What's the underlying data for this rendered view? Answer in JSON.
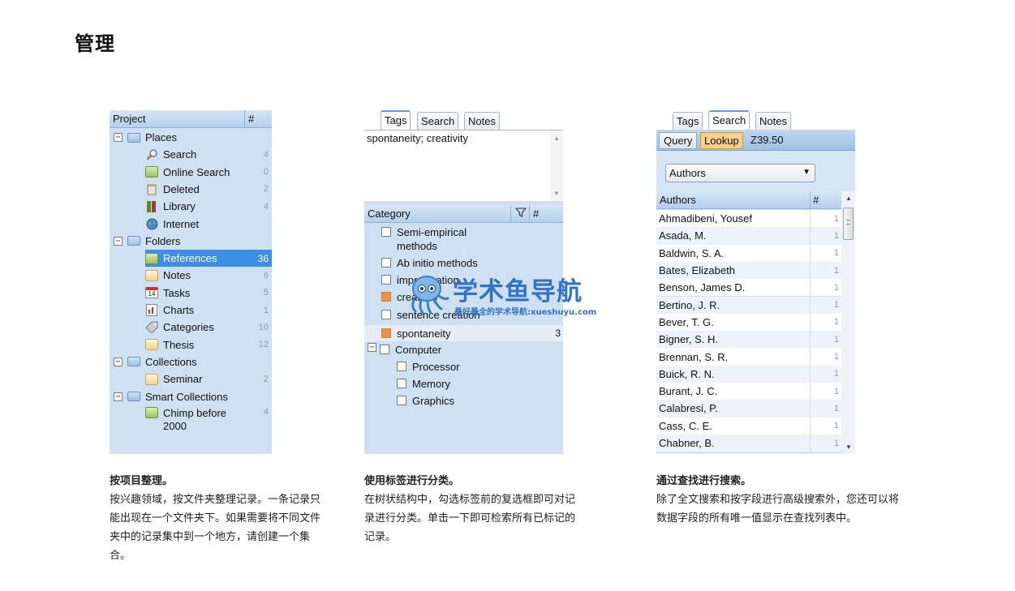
{
  "page": {
    "title": "管理"
  },
  "project_panel": {
    "header": {
      "project_label": "Project",
      "count_label": "#"
    },
    "tree": [
      {
        "label": "Places",
        "kind": "group",
        "count": ""
      },
      {
        "label": "Search",
        "kind": "search-icon",
        "count": "4"
      },
      {
        "label": "Online Search",
        "kind": "online-search-icon",
        "count": "0"
      },
      {
        "label": "Deleted",
        "kind": "trash-icon",
        "count": "2"
      },
      {
        "label": "Library",
        "kind": "library-icon",
        "count": "4"
      },
      {
        "label": "Internet",
        "kind": "globe-icon",
        "count": ""
      },
      {
        "label": "Folders",
        "kind": "group",
        "count": ""
      },
      {
        "label": "References",
        "kind": "folder-green-icon",
        "count": "36",
        "selected": true
      },
      {
        "label": "Notes",
        "kind": "note-icon",
        "count": "6"
      },
      {
        "label": "Tasks",
        "kind": "calendar-icon",
        "count": "5"
      },
      {
        "label": "Charts",
        "kind": "chart-icon",
        "count": "1"
      },
      {
        "label": "Categories",
        "kind": "tag-icon",
        "count": "10"
      },
      {
        "label": "Thesis",
        "kind": "note-icon",
        "count": "12"
      },
      {
        "label": "Collections",
        "kind": "group",
        "count": ""
      },
      {
        "label": "Seminar",
        "kind": "note-icon",
        "count": "2"
      },
      {
        "label": "Smart Collections",
        "kind": "group",
        "count": ""
      },
      {
        "label": "Chimp before",
        "label2": "2000",
        "kind": "folder-green-icon",
        "count": "4"
      }
    ]
  },
  "tags_panel": {
    "tabs": [
      "Tags",
      "Search",
      "Notes"
    ],
    "tags_text": "spontaneity; creativity",
    "category_header": {
      "label": "Category",
      "filter_icon": "filter-icon",
      "count_label": "#"
    },
    "categories": [
      {
        "label": "Semi-empirical",
        "label2": "methods",
        "checked": false,
        "count": ""
      },
      {
        "label": "Ab initio methods",
        "checked": false,
        "count": ""
      },
      {
        "label": "improvisation",
        "checked": false,
        "count": ""
      },
      {
        "label": "creativity",
        "checked": true,
        "count": ""
      },
      {
        "label": "sentence creation",
        "checked": false,
        "count": ""
      },
      {
        "label": "spontaneity",
        "checked": true,
        "count": "3"
      },
      {
        "label": "Computer",
        "checked": false,
        "count": ""
      },
      {
        "label": "Processor",
        "checked": false,
        "count": ""
      },
      {
        "label": "Memory",
        "checked": false,
        "count": ""
      },
      {
        "label": "Graphics",
        "checked": false,
        "count": ""
      }
    ]
  },
  "search_panel": {
    "tabs": [
      "Tags",
      "Search",
      "Notes"
    ],
    "subtabs": [
      "Query",
      "Lookup"
    ],
    "lookup_value": "Z39.50",
    "field_select": "Authors",
    "list_header": {
      "label": "Authors",
      "count_label": "#"
    },
    "authors": [
      {
        "name": "Ahmadibeni, Yousef",
        "count": "1"
      },
      {
        "name": "Asada, M.",
        "count": "1"
      },
      {
        "name": "Baldwin, S. A.",
        "count": "1"
      },
      {
        "name": "Bates, Elizabeth",
        "count": "1"
      },
      {
        "name": "Benson, James D.",
        "count": "1"
      },
      {
        "name": "Bertino, J. R.",
        "count": "1"
      },
      {
        "name": "Bever, T. G.",
        "count": "1"
      },
      {
        "name": "Bigner, S. H.",
        "count": "1"
      },
      {
        "name": "Brennan, S. R.",
        "count": "1"
      },
      {
        "name": "Buick, R. N.",
        "count": "1"
      },
      {
        "name": "Burant, J. C.",
        "count": "1"
      },
      {
        "name": "Calabresi, P.",
        "count": "1"
      },
      {
        "name": "Cass, C. E.",
        "count": "1"
      },
      {
        "name": "Chabner, B.",
        "count": "1"
      }
    ]
  },
  "captions": [
    {
      "title": "按项目整理。",
      "body": "按兴趣领域，按文件夹整理记录。一条记录只能出现在一个文件夹下。如果需要将不同文件夹中的记录集中到一个地方，请创建一个集合。"
    },
    {
      "title": "使用标签进行分类。",
      "body": "在树状结构中，勾选标签前的复选框即可对记录进行分类。单击一下即可检索所有已标记的记录。"
    },
    {
      "title": "通过查找进行搜索。",
      "body": "除了全文搜索和按字段进行高级搜索外，您还可以将数据字段的所有唯一值显示在查找列表中。"
    }
  ],
  "watermark": {
    "title": "学术鱼导航",
    "subtitle": "最好最全的学术导航:xueshuyu.com"
  }
}
